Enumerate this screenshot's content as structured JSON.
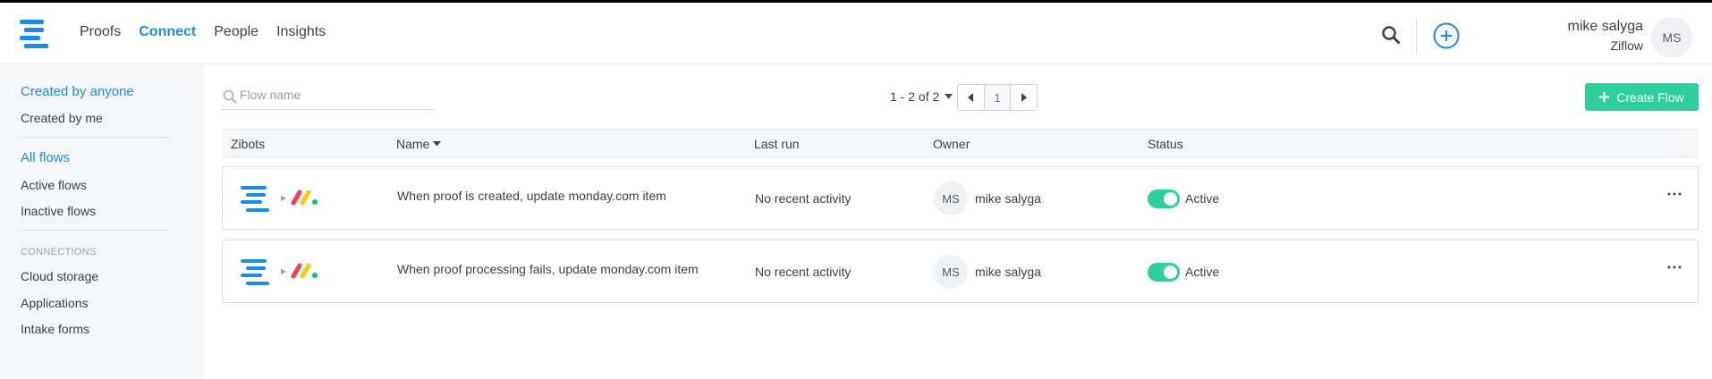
{
  "nav": {
    "items": [
      {
        "label": "Proofs",
        "active": false
      },
      {
        "label": "Connect",
        "active": true
      },
      {
        "label": "People",
        "active": false
      },
      {
        "label": "Insights",
        "active": false
      }
    ]
  },
  "user": {
    "name": "mike salyga",
    "org": "Ziflow",
    "initials": "MS"
  },
  "sidebar": {
    "filters": [
      {
        "label": "Created by anyone",
        "active": true
      },
      {
        "label": "Created by me",
        "active": false
      }
    ],
    "flows": [
      {
        "label": "All flows",
        "active": true
      },
      {
        "label": "Active flows",
        "active": false
      },
      {
        "label": "Inactive flows",
        "active": false
      }
    ],
    "connections_heading": "CONNECTIONS",
    "connections": [
      {
        "label": "Cloud storage"
      },
      {
        "label": "Applications"
      },
      {
        "label": "Intake forms"
      }
    ]
  },
  "search": {
    "placeholder": "Flow name",
    "value": ""
  },
  "pagination": {
    "range_text": "1 - 2 of 2",
    "current_page": "1"
  },
  "create_button": {
    "label": "Create Flow"
  },
  "table": {
    "columns": {
      "zibots": "Zibots",
      "name": "Name",
      "last_run": "Last run",
      "owner": "Owner",
      "status": "Status"
    },
    "rows": [
      {
        "name": "When proof is created, update monday.com item",
        "last_run": "No recent activity",
        "owner_initials": "MS",
        "owner_name": "mike salyga",
        "status": "Active",
        "enabled": true
      },
      {
        "name": "When proof processing fails, update monday.com item",
        "last_run": "No recent activity",
        "owner_initials": "MS",
        "owner_name": "mike salyga",
        "status": "Active",
        "enabled": true
      }
    ]
  },
  "colors": {
    "accent": "#1d8de4",
    "success": "#2dcf9c",
    "sidebar_bg": "#f4f6f8"
  },
  "icons": [
    "ziflow-logo-icon",
    "search-icon",
    "add-circle-icon",
    "caret-down-icon",
    "chevron-left-icon",
    "chevron-right-icon",
    "plus-icon",
    "zibot-icon",
    "monday-logo-icon",
    "more-icon"
  ]
}
